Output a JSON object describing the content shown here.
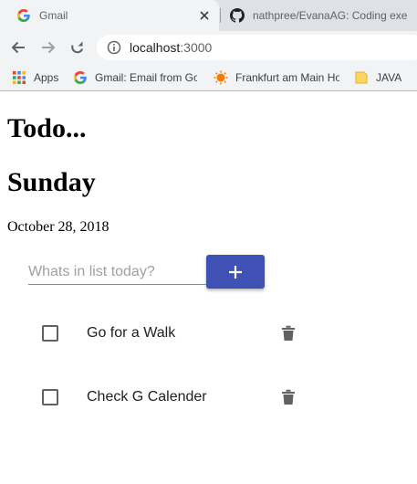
{
  "browser": {
    "tabs": [
      {
        "title": "Gmail",
        "icon": "google-icon",
        "active": true
      },
      {
        "title": "nathpree/EvanaAG: Coding exe",
        "icon": "github-icon",
        "active": false
      }
    ],
    "address_bar": {
      "host": "localhost",
      "port": ":3000"
    },
    "bookmarks": [
      {
        "label": "Apps",
        "icon": "apps-grid-icon"
      },
      {
        "label": "Gmail: Email from Go",
        "icon": "google-icon"
      },
      {
        "label": "Frankfurt am Main Ho",
        "icon": "weather-icon"
      },
      {
        "label": "JAVA",
        "icon": "folder-icon"
      }
    ]
  },
  "page": {
    "title": "Todo...",
    "day": "Sunday",
    "date": "October 28, 2018",
    "input": {
      "placeholder": "Whats in list today?",
      "value": ""
    },
    "add_button": {
      "icon": "plus-icon",
      "color": "#3f51b5"
    },
    "todos": [
      {
        "label": "Go for a Walk",
        "checked": false
      },
      {
        "label": "Check G Calender",
        "checked": false
      }
    ]
  }
}
